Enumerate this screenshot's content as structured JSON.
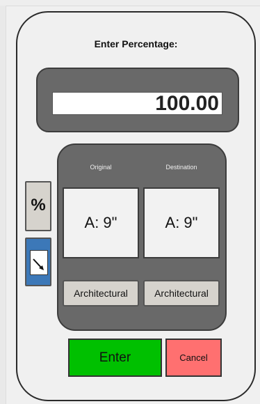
{
  "dialog": {
    "title": "Enter Percentage:",
    "value": "100.00",
    "percent_button_label": "%",
    "original": {
      "label": "Original",
      "value": "A: 9\"",
      "unit": "Architectural"
    },
    "destination": {
      "label": "Destination",
      "value": "A: 9\"",
      "unit": "Architectural"
    },
    "enter_label": "Enter",
    "cancel_label": "Cancel"
  },
  "icons": {
    "arrow_button": "diagonal-arrow-icon"
  },
  "colors": {
    "enter": "#00c000",
    "cancel": "#ff7070",
    "panel": "#696969",
    "arrow_button": "#3c78b8"
  }
}
